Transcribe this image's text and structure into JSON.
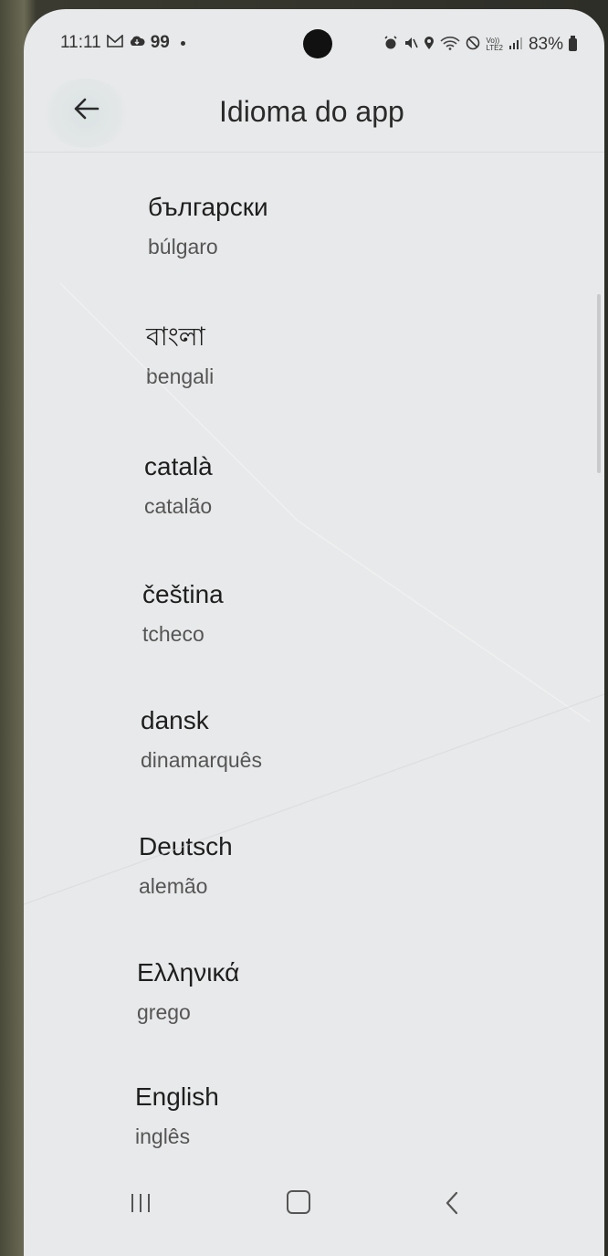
{
  "status_bar": {
    "time": "11:11",
    "notification_count": "99",
    "battery_percent": "83%",
    "network_label": "Vo))\nLTE2",
    "icons": [
      "gmail-icon",
      "cloud-icon",
      "dot-icon",
      "alarm-icon",
      "mute-icon",
      "location-icon",
      "wifi-icon",
      "do-not-disturb-icon",
      "signal-icon",
      "battery-icon"
    ]
  },
  "app_bar": {
    "title": "Idioma do app",
    "back_icon": "arrow-back-icon"
  },
  "languages": [
    {
      "native": "български",
      "translated": "búlgaro"
    },
    {
      "native": "বাংলা",
      "translated": "bengali"
    },
    {
      "native": "català",
      "translated": "catalão"
    },
    {
      "native": "čeština",
      "translated": "tcheco"
    },
    {
      "native": "dansk",
      "translated": "dinamarquês"
    },
    {
      "native": "Deutsch",
      "translated": "alemão"
    },
    {
      "native": "Ελληνικά",
      "translated": "grego"
    },
    {
      "native": "English",
      "translated": "inglês"
    }
  ],
  "nav_bar": {
    "icons": [
      "recent-apps-icon",
      "home-icon",
      "back-icon"
    ]
  },
  "colors": {
    "background": "#e8e9ea",
    "text_primary": "#1e1e1e",
    "text_secondary": "#555555"
  }
}
